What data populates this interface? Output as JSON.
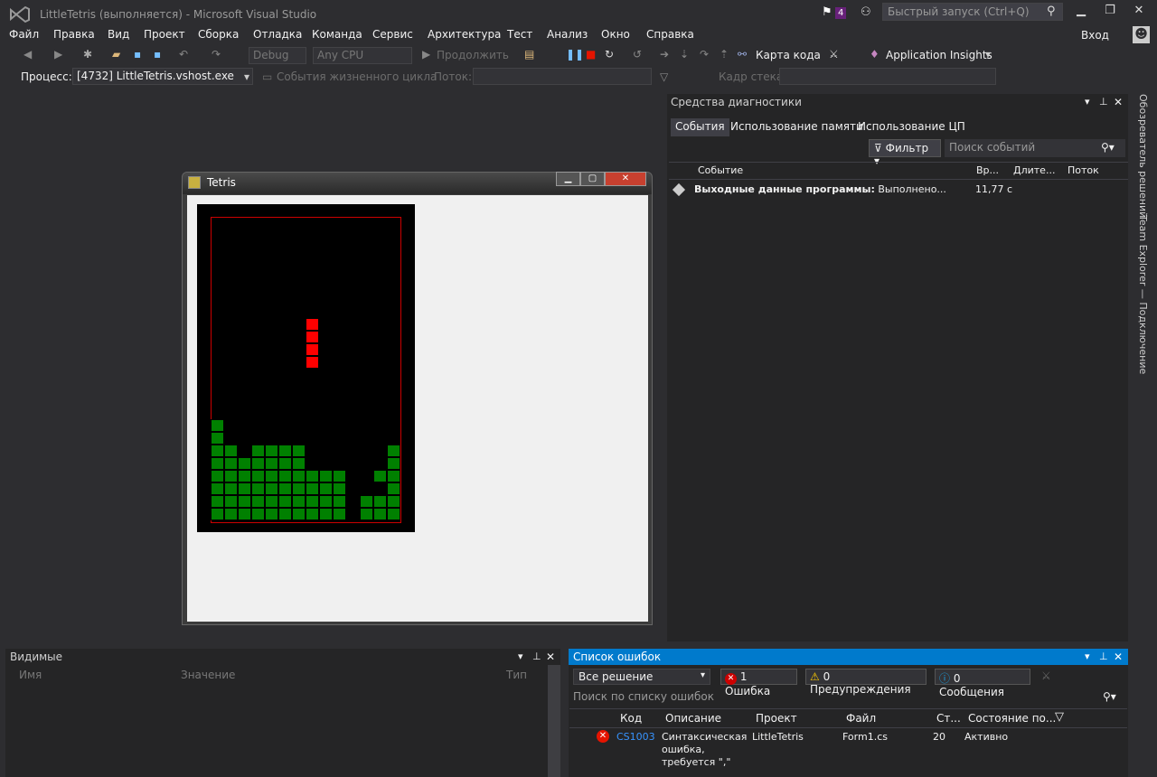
{
  "app": {
    "title": "LittleTetris (выполняется) - Microsoft Visual Studio",
    "notifications": "4",
    "quick_launch": "Быстрый запуск (Ctrl+Q)",
    "login": "Вход"
  },
  "menu": [
    "Файл",
    "Правка",
    "Вид",
    "Проект",
    "Сборка",
    "Отладка",
    "Команда",
    "Сервис",
    "Архитектура",
    "Тест",
    "Анализ",
    "Окно",
    "Справка"
  ],
  "toolbar": {
    "config": "Debug",
    "platform": "Any CPU",
    "continue": "Продолжить",
    "code_map": "Карта кода",
    "insights": "Application Insights"
  },
  "toolbar2": {
    "process_label": "Процесс:",
    "process_value": "[4732] LittleTetris.vshost.exe",
    "lifecycle": "События жизненного цикла",
    "thread": "Поток:",
    "stack": "Кадр стека:"
  },
  "diagnostics": {
    "title": "Средства диагностики",
    "tabs": [
      "События",
      "Использование памяти",
      "Использование ЦП"
    ],
    "filter": "Фильтр",
    "search_placeholder": "Поиск событий",
    "columns": [
      "Событие",
      "Вр...",
      "Длите...",
      "Поток"
    ],
    "row": {
      "label": "Выходные данные программы:",
      "text": "Выполнено...",
      "time": "11,77 с"
    }
  },
  "side_tabs": [
    "Обозреватель решений",
    "Team Explorer — Подключение"
  ],
  "tetris": {
    "title": "Tetris"
  },
  "watch": {
    "title": "Видимые",
    "columns": [
      "Имя",
      "Значение",
      "Тип"
    ]
  },
  "errors": {
    "title": "Список ошибок",
    "scope": "Все решение",
    "errors_btn": "1 Ошибка",
    "warnings_btn": "0 Предупреждения",
    "messages_btn": "0 Сообщения",
    "search": "Поиск по списку ошибок",
    "columns": [
      "Код",
      "Описание",
      "Проект",
      "Файл",
      "Ст...",
      "Состояние по..."
    ],
    "row": {
      "code": "CS1003",
      "description": "Синтаксическая ошибка, требуется \",\"",
      "project": "LittleTetris",
      "file": "Form1.cs",
      "line": "20",
      "state": "Активно"
    }
  },
  "colors": {
    "accent": "#007acc",
    "piece": "#ff0000",
    "stack": "#008000"
  }
}
